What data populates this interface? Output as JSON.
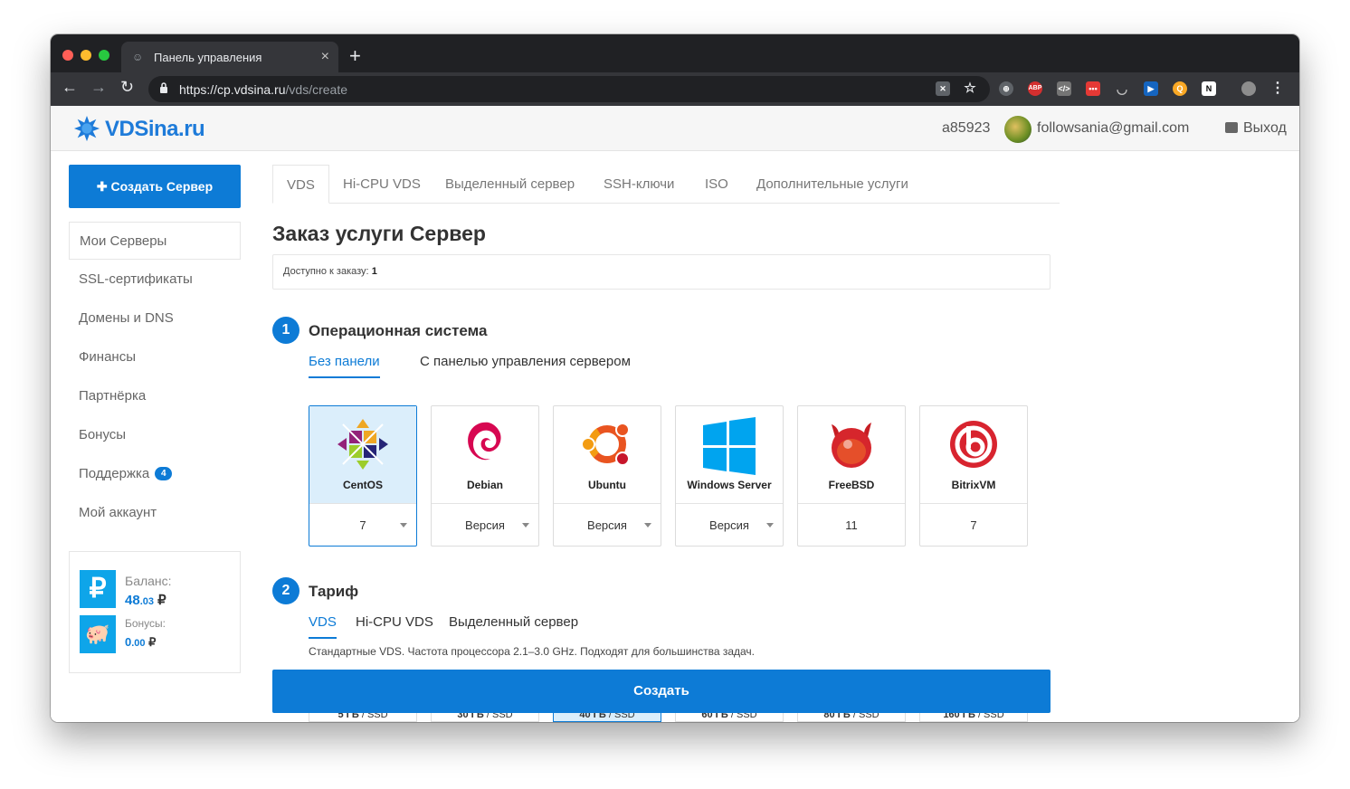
{
  "browser": {
    "tab_title": "Панель управления",
    "url_host": "https://cp.vdsina.ru",
    "url_path": "/vds/create"
  },
  "header": {
    "logo_text": "VDSina.ru",
    "user_id": "a85923",
    "email": "followsania@gmail.com",
    "logout_label": "Выход"
  },
  "sidebar": {
    "create_label": "Создать Сервер",
    "items": [
      {
        "label": "Мои Серверы"
      },
      {
        "label": "SSL-сертификаты"
      },
      {
        "label": "Домены и DNS"
      },
      {
        "label": "Финансы"
      },
      {
        "label": "Партнёрка"
      },
      {
        "label": "Бонусы"
      },
      {
        "label": "Поддержка",
        "badge": "4"
      },
      {
        "label": "Мой аккаунт"
      }
    ],
    "balance": {
      "balance_label": "Баланс:",
      "balance_int": "48",
      "balance_dec": ".03",
      "bonus_label": "Бонусы:",
      "bonus_int": "0",
      "bonus_dec": ".00",
      "currency": "₽"
    }
  },
  "main": {
    "tabs": [
      "VDS",
      "Hi-CPU VDS",
      "Выделенный сервер",
      "SSH-ключи",
      "ISO",
      "Дополнительные услуги"
    ],
    "title": "Заказ услуги Сервер",
    "available_label": "Доступно к заказу:",
    "available_count": "1",
    "step1": {
      "number": "1",
      "title": "Операционная система",
      "subtabs": [
        "Без панели",
        "С панелью управления сервером"
      ]
    },
    "os_list": [
      {
        "name": "CentOS",
        "version": "7",
        "selected": true,
        "has_dropdown": true
      },
      {
        "name": "Debian",
        "version": "Версия",
        "has_dropdown": true
      },
      {
        "name": "Ubuntu",
        "version": "Версия",
        "has_dropdown": true
      },
      {
        "name": "Windows Server",
        "version": "Версия",
        "has_dropdown": true
      },
      {
        "name": "FreeBSD",
        "version": "11",
        "has_dropdown": false
      },
      {
        "name": "BitrixVM",
        "version": "7",
        "has_dropdown": false
      }
    ],
    "step2": {
      "number": "2",
      "title": "Тариф",
      "subtabs": [
        "VDS",
        "Hi-CPU VDS",
        "Выделенный сервер"
      ],
      "description": "Стандартные VDS. Частота процессора 2.1–3.0 GHz. Подходят для большинства задач."
    },
    "submit_label": "Создать",
    "plans": [
      {
        "size": "5 ГБ",
        "type": "/ SSD"
      },
      {
        "size": "30 ГБ",
        "type": "/ SSD"
      },
      {
        "size": "40 ГБ",
        "type": "/ SSD",
        "selected": true
      },
      {
        "size": "60 ГБ",
        "type": "/ SSD"
      },
      {
        "size": "80 ГБ",
        "type": "/ SSD"
      },
      {
        "size": "160 ГБ",
        "type": "/ SSD"
      }
    ]
  },
  "colors": {
    "accent": "#0d7bd6",
    "selected_bg": "#dbeefb"
  }
}
